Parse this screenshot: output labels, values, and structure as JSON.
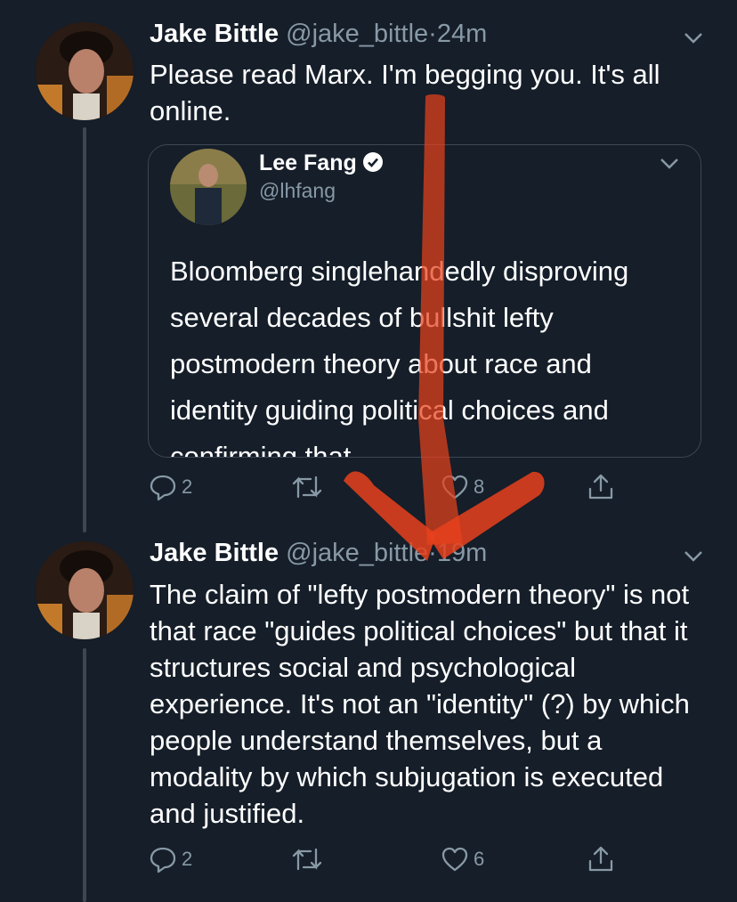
{
  "tweets": [
    {
      "name": "Jake Bittle",
      "handle": "@jake_bittle",
      "dot": "·",
      "time": "24m",
      "text": "Please read Marx. I'm begging you. It's all online.",
      "replies": "2",
      "retweets": "",
      "likes": "8"
    },
    {
      "name": "Jake Bittle",
      "handle": "@jake_bittle",
      "dot": "·",
      "time": "19m",
      "text": "The claim of \"lefty postmodern theory\" is not that race \"guides political choices\" but that it structures social and psychological experience. It's not an \"identity\" (?) by which people understand themselves, but a modality by which subjugation is executed and justified.",
      "replies": "2",
      "retweets": "",
      "likes": "6"
    }
  ],
  "quote": {
    "name": "Lee Fang",
    "handle": "@lhfang",
    "text": "Bloomberg singlehandedly disproving several decades of bullshit lefty postmodern theory about race and identity guiding political choices and confirming that"
  },
  "icons": {
    "reply": "reply-icon",
    "retweet": "retweet-icon",
    "like": "heart-icon",
    "share": "share-icon",
    "more": "chevron-down-icon",
    "verified": "verified-badge-icon"
  },
  "colors": {
    "background": "#151e29",
    "secondary_text": "#8899a6",
    "arrow": "#e8411c",
    "verified": "#ffffff"
  }
}
